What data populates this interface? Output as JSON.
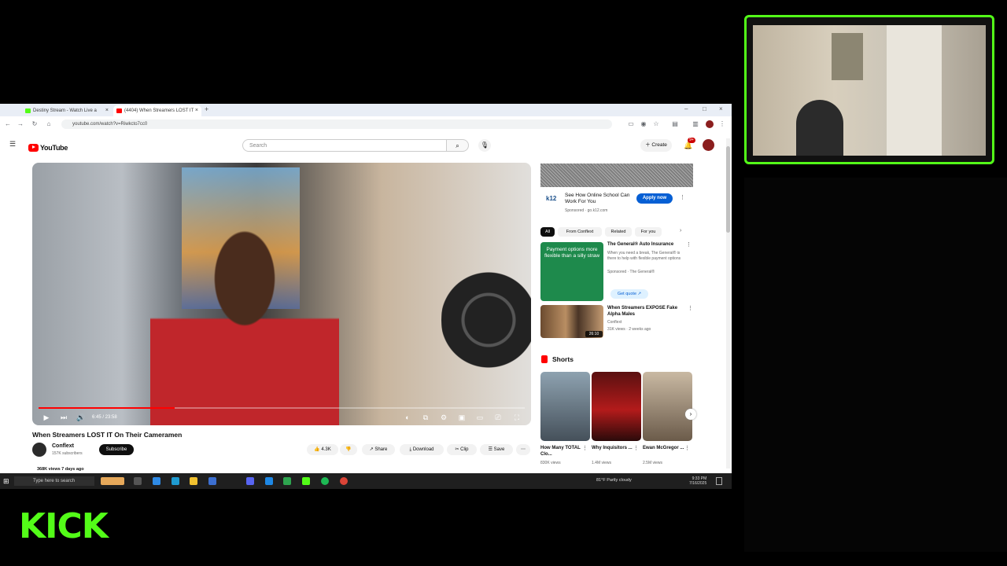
{
  "overlay": {
    "brand": "KICK"
  },
  "tabs": [
    {
      "label": "Destiny Stream - Watch Live a",
      "favicon_color": "#53fc18"
    },
    {
      "label": "(4404) When Streamers LOST IT",
      "favicon_color": "#ff0000"
    }
  ],
  "address": {
    "url": "youtube.com/watch?v=Riwkcto7cc0"
  },
  "youtube": {
    "logo_text": "YouTube",
    "search_placeholder": "Search",
    "create_label": "Create",
    "notification_count": "9+"
  },
  "player": {
    "time": "6:45 / 23:58",
    "progress": 0.28
  },
  "video": {
    "title": "When Streamers LOST IT On Their Cameramen",
    "channel": "Conflext",
    "subscribers": "157K subscribers",
    "subscribe_label": "Subscribe",
    "likes": "4.3K",
    "share_label": "Share",
    "download_label": "Download",
    "clip_label": "Clip",
    "save_label": "Save",
    "stats": "368K views  7 days ago"
  },
  "sidebar": {
    "ad1": {
      "logo": "k12",
      "text": "See How Online School Can Work For You",
      "sponsored": "Sponsored · go.k12.com",
      "cta": "Apply now"
    },
    "chips": [
      "All",
      "From Conflext",
      "Related",
      "For you"
    ],
    "ad2": {
      "thumb_text": "Payment options more flexible than a silly straw",
      "title": "The General® Auto Insurance",
      "desc": "When you need a break, The General® is there to help with flexible payment options",
      "sponsored": "Sponsored · The General®",
      "cta": "Get quote"
    },
    "video": {
      "title": "When Streamers EXPOSE Fake Alpha Males",
      "channel": "Conflext",
      "meta": "31K views · 2 weeks ago",
      "duration": "26:10"
    },
    "shorts_title": "Shorts",
    "shorts": [
      {
        "title": "How Many TOTAL Clo...",
        "views": "830K views"
      },
      {
        "title": "Why Inquisitors ...",
        "views": "1.4M views"
      },
      {
        "title": "Ewan McGregor ...",
        "views": "2.5M views"
      }
    ]
  },
  "taskbar": {
    "search_placeholder": "Type here to search",
    "weather": "81°F  Partly cloudy",
    "time": "9:33 PM",
    "date": "7/16/2025"
  }
}
